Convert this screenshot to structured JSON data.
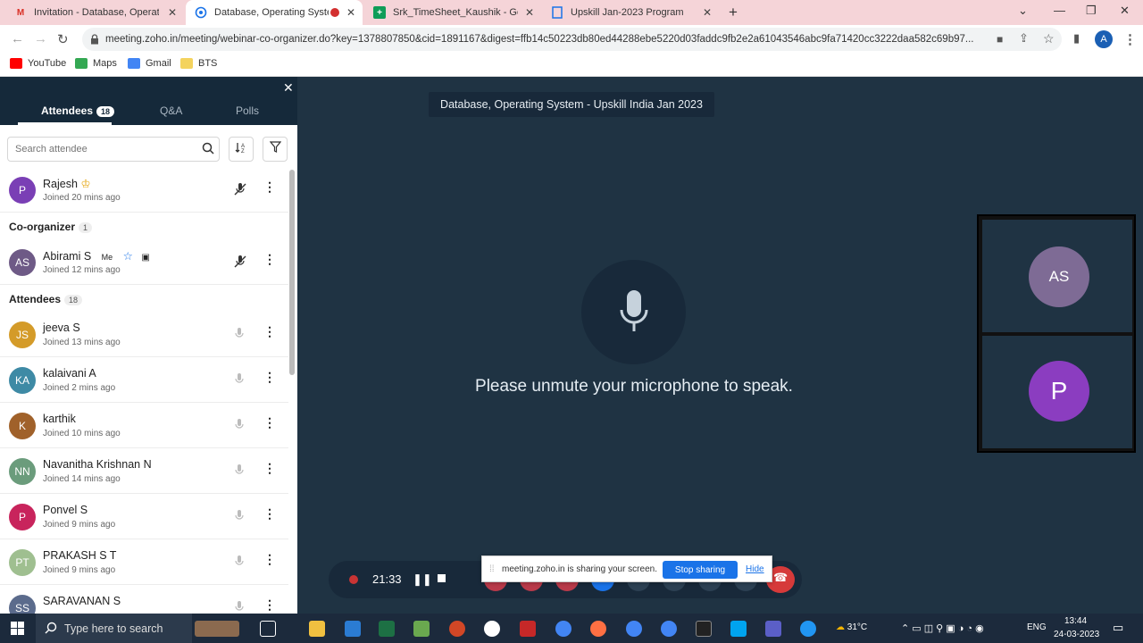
{
  "browser": {
    "tabs": [
      {
        "label": "Invitation - Database, Operating",
        "icon": "gmail-icon"
      },
      {
        "label": "Database, Operating System",
        "icon": "zoho-icon"
      },
      {
        "label": "Srk_TimeSheet_Kaushik - Google",
        "icon": "sheets-icon"
      },
      {
        "label": "Upskill Jan-2023 Program",
        "icon": "doc-icon"
      }
    ],
    "url": "meeting.zoho.in/meeting/webinar-co-organizer.do?key=1378807850&cid=1891167&digest=ffb14c50223db80ed44288ebe5220d03faddc9fb2e2a61043546abc9fa71420cc3222daa582c69b97...",
    "bookmarks": [
      {
        "label": "YouTube",
        "color": "#ff0000"
      },
      {
        "label": "Maps",
        "color": "#34a853"
      },
      {
        "label": "Gmail",
        "color": "#4285f4"
      },
      {
        "label": "BTS",
        "color": "#f4d35e"
      }
    ],
    "profile_initial": "A"
  },
  "panel": {
    "tabs": {
      "attendees": "Attendees",
      "attendees_count": "18",
      "qa": "Q&A",
      "polls": "Polls"
    },
    "search_placeholder": "Search attendee",
    "host": {
      "name": "Rajesh",
      "joined": "Joined 20 mins ago",
      "initials": "P",
      "color": "#7a3fb5"
    },
    "coorg_label": "Co-organizer",
    "coorg_count": "1",
    "coorg": {
      "name": "Abirami S",
      "me": "Me",
      "joined": "Joined 12 mins ago",
      "initials": "AS",
      "color": "#6e5a86"
    },
    "attendees_label": "Attendees",
    "attendees_count": "18",
    "attendees": [
      {
        "name": "jeeva S",
        "joined": "Joined 13 mins ago",
        "initials": "JS",
        "color": "#d49b29"
      },
      {
        "name": "kalaivani A",
        "joined": "Joined 2 mins ago",
        "initials": "KA",
        "color": "#3e8aa5"
      },
      {
        "name": "karthik",
        "joined": "Joined 10 mins ago",
        "initials": "K",
        "color": "#a0612a"
      },
      {
        "name": "Navanitha Krishnan N",
        "joined": "Joined 14 mins ago",
        "initials": "NN",
        "color": "#6b9c7c"
      },
      {
        "name": "Ponvel S",
        "joined": "Joined 9 mins ago",
        "initials": "P",
        "color": "#c8245c"
      },
      {
        "name": "PRAKASH S T",
        "joined": "Joined 9 mins ago",
        "initials": "PT",
        "color": "#9fbf90"
      },
      {
        "name": "SARAVANAN S",
        "joined": "",
        "initials": "SS",
        "color": "#5b6b8c"
      }
    ]
  },
  "main": {
    "meeting_title": "Database, Operating System - Upskill India Jan 2023",
    "unmute_message": "Please unmute your microphone to speak.",
    "tiles": [
      {
        "initials": "AS",
        "color": "#7e6b95"
      },
      {
        "initials": "P",
        "color": "#8b3dc0"
      }
    ],
    "rec_time": "21:33",
    "share_text": "meeting.zoho.in is sharing your screen.",
    "stop_sharing": "Stop sharing",
    "hide": "Hide"
  },
  "taskbar": {
    "search": "Type here to search",
    "weather": "31°C",
    "lang": "ENG",
    "time": "13:44",
    "date": "24-03-2023"
  }
}
